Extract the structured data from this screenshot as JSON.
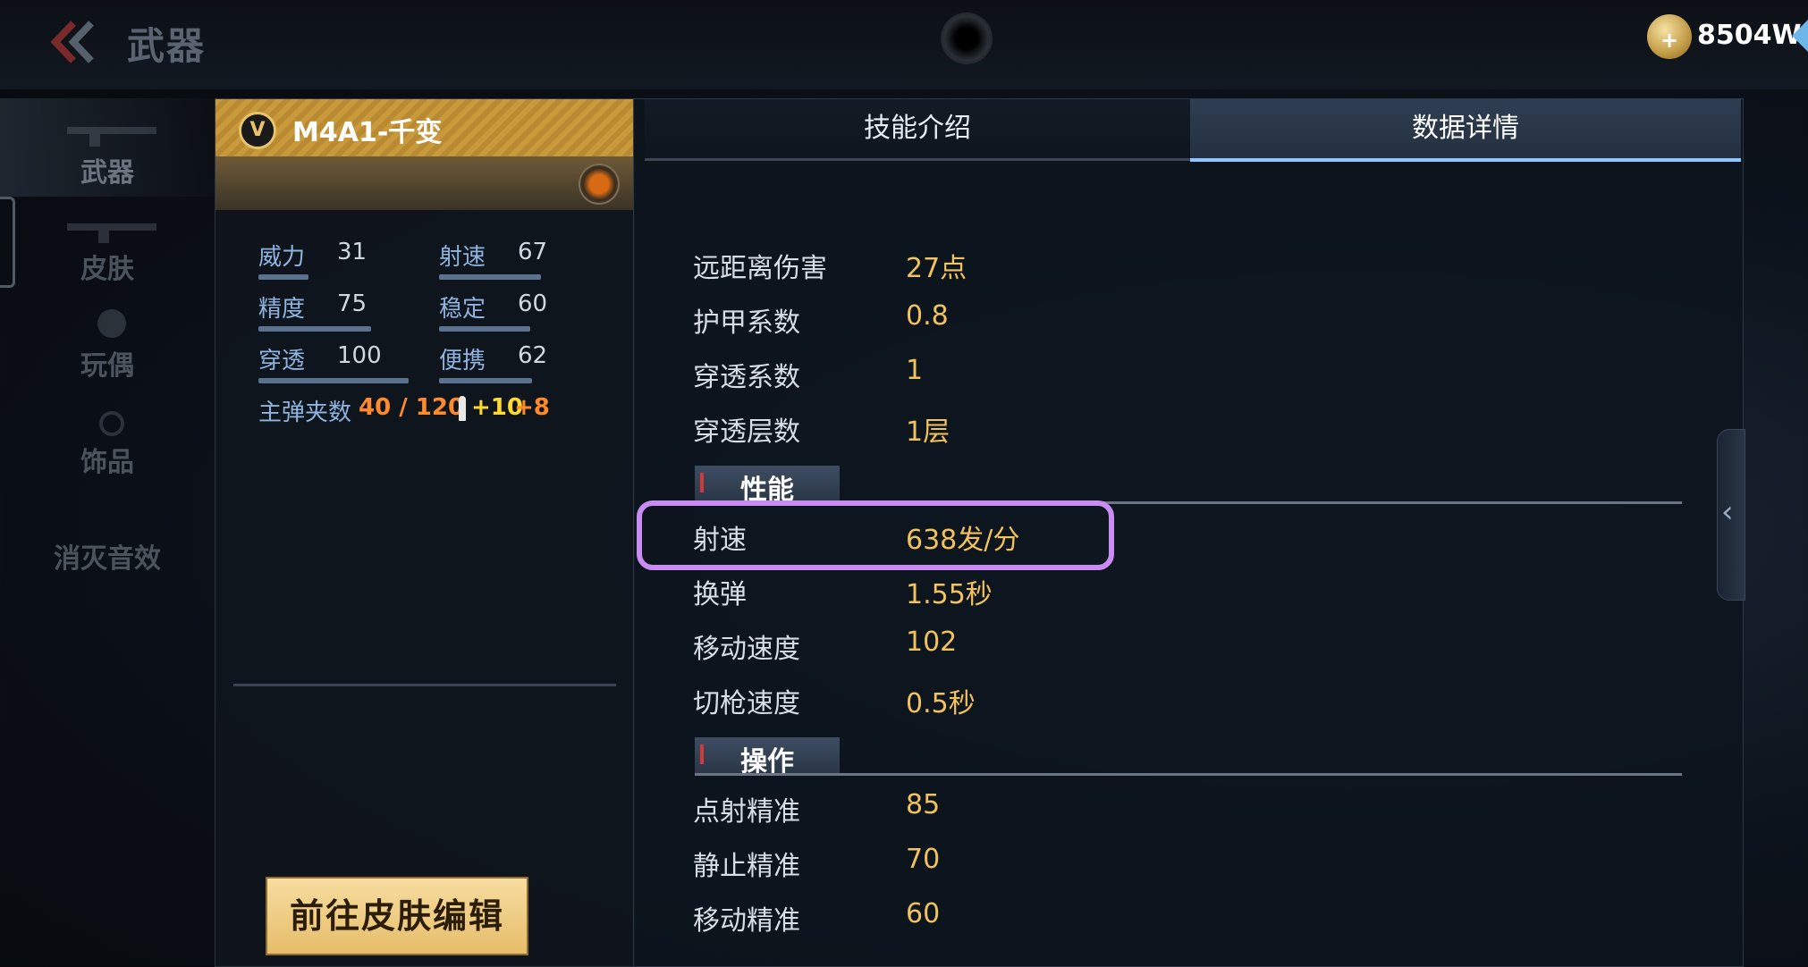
{
  "header": {
    "title": "武器",
    "currency_value": "8504W",
    "currency_plus": "+"
  },
  "nav": {
    "items": [
      {
        "label": "武器"
      },
      {
        "label": "皮肤"
      },
      {
        "label": "玩偶"
      },
      {
        "label": "饰品"
      },
      {
        "label": "消灭音效"
      }
    ]
  },
  "weapon": {
    "badge": "V",
    "name": "M4A1-千变",
    "stats": [
      {
        "label": "威力",
        "value": "31",
        "level": 31
      },
      {
        "label": "射速",
        "value": "67",
        "level": 67
      },
      {
        "label": "精度",
        "value": "75",
        "level": 75
      },
      {
        "label": "稳定",
        "value": "60",
        "level": 60
      },
      {
        "label": "穿透",
        "value": "100",
        "level": 100
      },
      {
        "label": "便携",
        "value": "62",
        "level": 62
      }
    ],
    "ammo_label": "主弹夹数",
    "ammo_value": "40 / 120",
    "ammo_bonus_a": "+10",
    "ammo_bonus_b": "+8",
    "skin_edit_button": "前往皮肤编辑"
  },
  "tabs": {
    "skills": "技能介绍",
    "data": "数据详情"
  },
  "details": {
    "rows_a": [
      {
        "key": "远距离伤害",
        "value": "27点"
      },
      {
        "key": "护甲系数",
        "value": "0.8"
      },
      {
        "key": "穿透系数",
        "value": "1"
      },
      {
        "key": "穿透层数",
        "value": "1层"
      }
    ],
    "section_performance": "性能",
    "rows_b": [
      {
        "key": "射速",
        "value": "638发/分"
      },
      {
        "key": "换弹",
        "value": "1.55秒"
      },
      {
        "key": "移动速度",
        "value": "102"
      },
      {
        "key": "切枪速度",
        "value": "0.5秒"
      }
    ],
    "section_operation": "操作",
    "rows_c": [
      {
        "key": "点射精准",
        "value": "85"
      },
      {
        "key": "静止精准",
        "value": "70"
      },
      {
        "key": "移动精准",
        "value": "60"
      }
    ]
  },
  "colors": {
    "accent_gold": "#f2c25c",
    "highlight": "#c98cf3",
    "stat_label": "#8fb4df",
    "ammo": "#ff8a2c"
  }
}
